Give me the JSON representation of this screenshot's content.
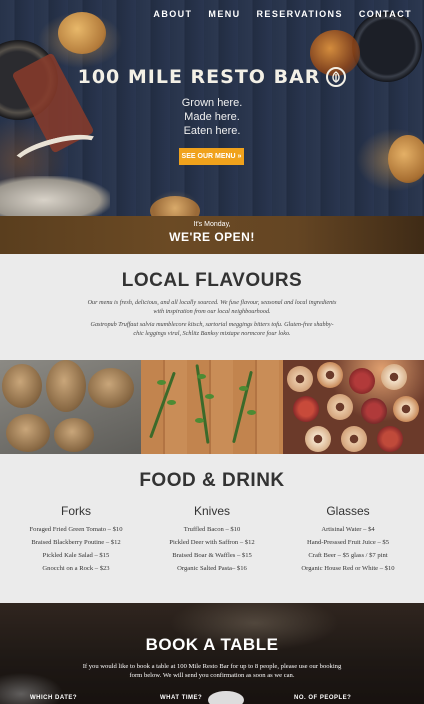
{
  "nav": {
    "items": [
      "ABOUT",
      "MENU",
      "RESERVATIONS",
      "CONTACT"
    ]
  },
  "hero": {
    "title": "100 MILE RESTO BAR",
    "tagline": [
      "Grown here.",
      "Made here.",
      "Eaten here."
    ],
    "button_label": "SEE OUR MENU »"
  },
  "open_bar": {
    "day": "It's Monday,",
    "status": "WE'RE OPEN!"
  },
  "flavours": {
    "title": "LOCAL FLAVOURS",
    "paragraph1": "Our menu is fresh, delicious, and all locally sourced. We fuse flavour, seasonal and local ingredients with inspiration from our local neighbourhood.",
    "paragraph2": "Gastropub Truffaut salvia mumblecore kitsch, sartorial meggings bitters tofu. Gluten-free shabby-chic leggings viral, Schlitz Banksy mixtape normcore four loko."
  },
  "food": {
    "title": "FOOD & DRINK",
    "columns": [
      {
        "heading": "Forks",
        "items": [
          "Foraged Fried Green Tomato – $10",
          "Braised Blackberry Poutine – $12",
          "Pickled Kale Salad – $15",
          "Gnocchi on a Rock – $23"
        ]
      },
      {
        "heading": "Knives",
        "items": [
          "Truffled Bacon – $10",
          "Pickled Deer with Saffron – $12",
          "Braised Boar & Waffles – $15",
          "Organic Salted Pasta– $16"
        ]
      },
      {
        "heading": "Glasses",
        "items": [
          "Artisinal Water – $4",
          "Hand-Presssed Fruit Juice – $5",
          "Craft Beer – $5 glass / $7 pint",
          "Organic House Red or White – $10"
        ]
      }
    ]
  },
  "book": {
    "title": "BOOK A TABLE",
    "text": "If you would like to book a table at 100 Mile Resto Bar for up to 8 people, please use our booking form below. We will send you confirmation as soon as we can.",
    "labels": [
      "WHICH DATE?",
      "WHAT TIME?",
      "NO. OF PEOPLE?"
    ]
  },
  "colors": {
    "accent": "#f0a21c",
    "open_bar": "#5a3e1e",
    "text": "#333333"
  },
  "icons": {
    "brand_badge": "leaf-icon"
  }
}
